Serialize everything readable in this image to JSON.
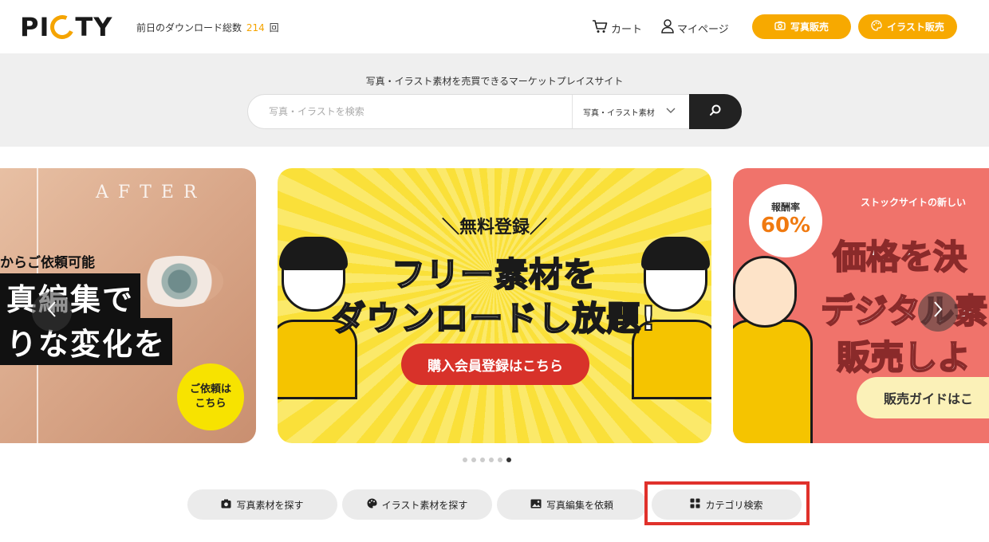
{
  "header": {
    "logo_text": "PICTY",
    "download_prefix": "前日のダウンロード総数",
    "download_count": "214",
    "download_suffix": "回",
    "cart_label": "カート",
    "mypage_label": "マイページ",
    "sell_photo_label": "写真販売",
    "sell_illust_label": "イラスト販売"
  },
  "search": {
    "tagline": "写真・イラスト素材を売買できるマーケットプレイスサイト",
    "placeholder": "写真・イラストを検索",
    "select_value": "写真・イラスト素材"
  },
  "carousel": {
    "slide_left": {
      "after_text": "AFTER",
      "sub_text": "からご依頼可能",
      "line1": "真編集で",
      "line2": "りな変化を",
      "request_line1": "ご依頼は",
      "request_line2": "こちら"
    },
    "slide_center": {
      "kicker": "＼無料登録／",
      "headline1": "フリー素材を",
      "headline2": "ダウンロードし放題!",
      "cta": "購入会員登録はこちら"
    },
    "slide_right": {
      "rate_label": "報酬率",
      "rate_value": "60%",
      "tag": "ストックサイトの新しい",
      "line1": "価格を決",
      "line2": "デジタル素",
      "line3": "販売しよ",
      "guide": "販売ガイドはこ"
    },
    "dot_count": 6,
    "active_dot": 6
  },
  "nav_buttons": {
    "photo": "写真素材を探す",
    "illust": "イラスト素材を探す",
    "edit": "写真編集を依頼",
    "category": "カテゴリ検索"
  },
  "colors": {
    "accent": "#f7a900",
    "dark": "#222222",
    "highlight": "#e0312b"
  },
  "icons": [
    "cart-icon",
    "user-icon",
    "camera-icon",
    "palette-icon",
    "search-icon",
    "chevron-down-icon",
    "arrow-left-icon",
    "arrow-right-icon",
    "image-icon",
    "grid-icon"
  ]
}
